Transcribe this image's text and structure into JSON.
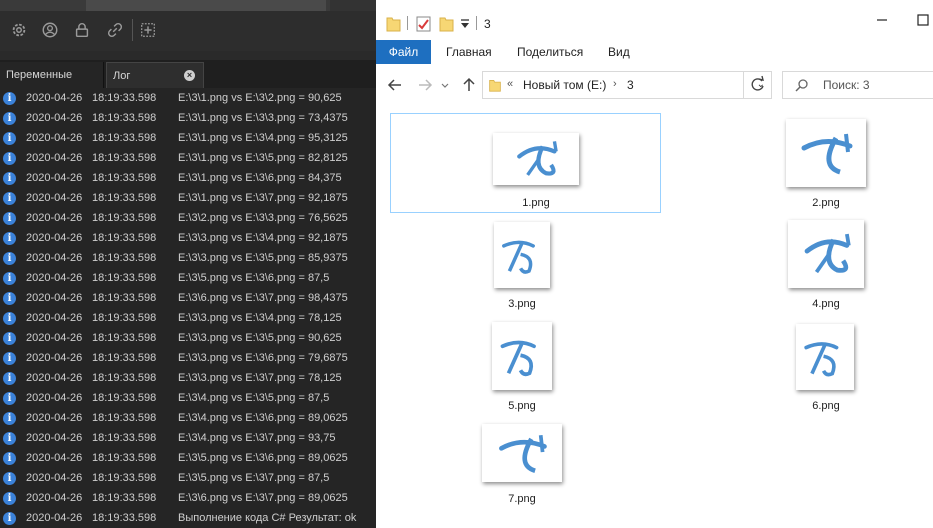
{
  "left_app": {
    "toolbar_icons": [
      "gear-icon",
      "user-icon",
      "lock-icon",
      "link-icon",
      "add-icon"
    ],
    "tabs": [
      {
        "label": "Переменные"
      },
      {
        "label": "Лог",
        "close": "×"
      }
    ],
    "info_glyph": "i",
    "log_rows": [
      {
        "date": "2020-04-26",
        "time": "18:19:33.598",
        "msg": "E:\\3\\1.png vs E:\\3\\2.png = 90,625"
      },
      {
        "date": "2020-04-26",
        "time": "18:19:33.598",
        "msg": "E:\\3\\1.png vs E:\\3\\3.png = 73,4375"
      },
      {
        "date": "2020-04-26",
        "time": "18:19:33.598",
        "msg": "E:\\3\\1.png vs E:\\3\\4.png = 95,3125"
      },
      {
        "date": "2020-04-26",
        "time": "18:19:33.598",
        "msg": "E:\\3\\1.png vs E:\\3\\5.png = 82,8125"
      },
      {
        "date": "2020-04-26",
        "time": "18:19:33.598",
        "msg": "E:\\3\\1.png vs E:\\3\\6.png = 84,375"
      },
      {
        "date": "2020-04-26",
        "time": "18:19:33.598",
        "msg": "E:\\3\\1.png vs E:\\3\\7.png = 92,1875"
      },
      {
        "date": "2020-04-26",
        "time": "18:19:33.598",
        "msg": "E:\\3\\2.png vs E:\\3\\3.png = 76,5625"
      },
      {
        "date": "2020-04-26",
        "time": "18:19:33.598",
        "msg": "E:\\3\\3.png vs E:\\3\\4.png = 92,1875"
      },
      {
        "date": "2020-04-26",
        "time": "18:19:33.598",
        "msg": "E:\\3\\3.png vs E:\\3\\5.png = 85,9375"
      },
      {
        "date": "2020-04-26",
        "time": "18:19:33.598",
        "msg": "E:\\3\\5.png vs E:\\3\\6.png = 87,5"
      },
      {
        "date": "2020-04-26",
        "time": "18:19:33.598",
        "msg": "E:\\3\\6.png vs E:\\3\\7.png = 98,4375"
      },
      {
        "date": "2020-04-26",
        "time": "18:19:33.598",
        "msg": "E:\\3\\3.png vs E:\\3\\4.png = 78,125"
      },
      {
        "date": "2020-04-26",
        "time": "18:19:33.598",
        "msg": "E:\\3\\3.png vs E:\\3\\5.png = 90,625"
      },
      {
        "date": "2020-04-26",
        "time": "18:19:33.598",
        "msg": "E:\\3\\3.png vs E:\\3\\6.png = 79,6875"
      },
      {
        "date": "2020-04-26",
        "time": "18:19:33.598",
        "msg": "E:\\3\\3.png vs E:\\3\\7.png = 78,125"
      },
      {
        "date": "2020-04-26",
        "time": "18:19:33.598",
        "msg": "E:\\3\\4.png vs E:\\3\\5.png = 87,5"
      },
      {
        "date": "2020-04-26",
        "time": "18:19:33.598",
        "msg": "E:\\3\\4.png vs E:\\3\\6.png = 89,0625"
      },
      {
        "date": "2020-04-26",
        "time": "18:19:33.598",
        "msg": "E:\\3\\4.png vs E:\\3\\7.png = 93,75"
      },
      {
        "date": "2020-04-26",
        "time": "18:19:33.598",
        "msg": "E:\\3\\5.png vs E:\\3\\6.png = 89,0625"
      },
      {
        "date": "2020-04-26",
        "time": "18:19:33.598",
        "msg": "E:\\3\\5.png vs E:\\3\\7.png = 87,5"
      },
      {
        "date": "2020-04-26",
        "time": "18:19:33.598",
        "msg": "E:\\3\\6.png vs E:\\3\\7.png = 89,0625"
      },
      {
        "date": "2020-04-26",
        "time": "18:19:33.598",
        "msg": "Выполнение кода C#  Результат: ok"
      }
    ]
  },
  "explorer": {
    "title": "3",
    "ribbon_tabs": [
      "Файл",
      "Главная",
      "Поделиться",
      "Вид"
    ],
    "address": {
      "prefix": "«",
      "drive": "Новый том (E:)",
      "folder": "3"
    },
    "search_placeholder": "Поиск: 3",
    "files": [
      {
        "name": "1.png",
        "selected": true
      },
      {
        "name": "2.png"
      },
      {
        "name": "3.png"
      },
      {
        "name": "4.png"
      },
      {
        "name": "5.png"
      },
      {
        "name": "6.png"
      },
      {
        "name": "7.png"
      }
    ],
    "colors": {
      "accent": "#1e6fc0",
      "selection_border": "#99d1ff",
      "glyph": "#4a8fd0"
    }
  }
}
